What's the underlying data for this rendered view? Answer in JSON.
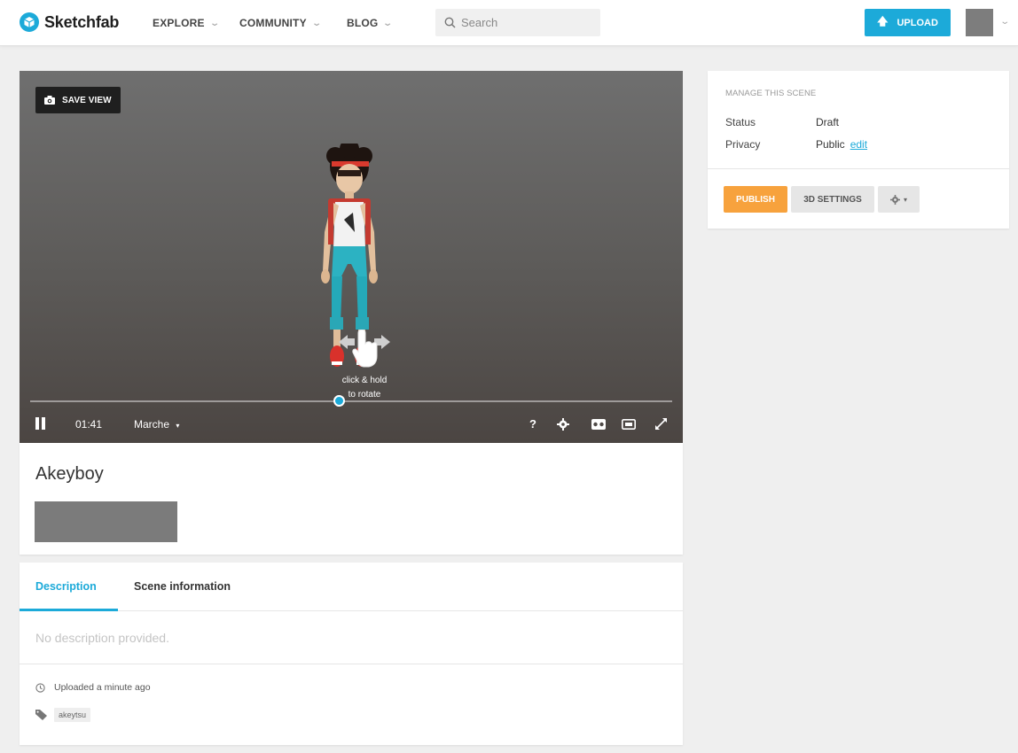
{
  "header": {
    "brand": "Sketchfab",
    "nav": [
      {
        "label": "EXPLORE"
      },
      {
        "label": "COMMUNITY"
      },
      {
        "label": "BLOG"
      }
    ],
    "search_placeholder": "Search",
    "upload_label": "UPLOAD"
  },
  "viewer": {
    "save_view_label": "SAVE VIEW",
    "hint_line1": "click & hold",
    "hint_line2": "to rotate",
    "time": "01:41",
    "animation": "Marche",
    "progress": 0.48,
    "help_label": "?"
  },
  "model": {
    "title": "Akeyboy"
  },
  "tabs": [
    {
      "label": "Description",
      "active": true
    },
    {
      "label": "Scene information",
      "active": false
    }
  ],
  "description": {
    "empty_text": "No description provided.",
    "uploaded": "Uploaded a minute ago",
    "tag": "akeytsu"
  },
  "manage": {
    "title": "MANAGE THIS SCENE",
    "status_label": "Status",
    "status_value": "Draft",
    "privacy_label": "Privacy",
    "privacy_value": "Public",
    "edit_label": "edit",
    "publish_label": "PUBLISH",
    "settings_label": "3D SETTINGS"
  },
  "colors": {
    "accent": "#1caad9",
    "publish": "#f7a23d"
  }
}
